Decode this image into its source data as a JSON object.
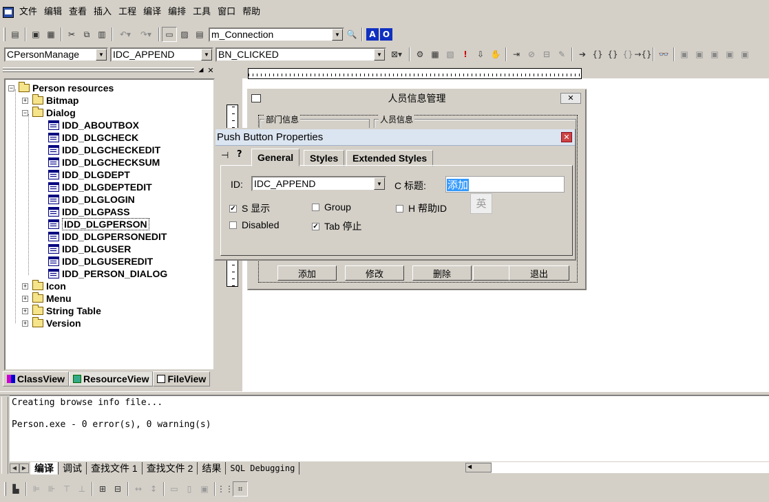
{
  "menu": [
    "文件",
    "编辑",
    "查看",
    "插入",
    "工程",
    "编译",
    "编排",
    "工具",
    "窗口",
    "帮助"
  ],
  "toolbar1": {
    "connection_combo": "m_Connection"
  },
  "toolbar2": {
    "class_combo": "CPersonManage",
    "id_combo": "IDC_APPEND",
    "message_combo": "BN_CLICKED"
  },
  "tree": {
    "root": "Person resources",
    "folders": [
      "Bitmap",
      "Dialog",
      "Icon",
      "Menu",
      "String Table",
      "Version"
    ],
    "dialogs": [
      "IDD_ABOUTBOX",
      "IDD_DLGCHECK",
      "IDD_DLGCHECKEDIT",
      "IDD_DLGCHECKSUM",
      "IDD_DLGDEPT",
      "IDD_DLGDEPTEDIT",
      "IDD_DLGLOGIN",
      "IDD_DLGPASS",
      "IDD_DLGPERSON",
      "IDD_DLGPERSONEDIT",
      "IDD_DLGUSER",
      "IDD_DLGUSEREDIT",
      "IDD_PERSON_DIALOG"
    ],
    "selected": "IDD_DLGPERSON"
  },
  "workspace_tabs": [
    "ClassView",
    "ResourceView",
    "FileView"
  ],
  "dialog": {
    "title": "人员信息管理",
    "group1": "部门信息",
    "group2": "人员信息",
    "buttons": [
      "添加",
      "修改",
      "删除",
      "退出"
    ]
  },
  "props": {
    "title": "Push Button Properties",
    "tabs": [
      "General",
      "Styles",
      "Extended Styles"
    ],
    "id_label": "ID:",
    "id_value": "IDC_APPEND",
    "caption_label": "C 标题:",
    "caption_value": "添加",
    "ime_char": "英",
    "checks": {
      "visible": "S 显示",
      "group": "Group",
      "helpid": "H 帮助ID",
      "disabled": "Disabled",
      "tabstop": "Tab 停止"
    }
  },
  "output": {
    "line1": "Creating browse info file...",
    "line2": "Person.exe - 0 error(s), 0 warning(s)"
  },
  "output_tabs": [
    "编译",
    "调试",
    "查找文件 1",
    "查找文件 2",
    "结果",
    "SQL Debugging"
  ]
}
